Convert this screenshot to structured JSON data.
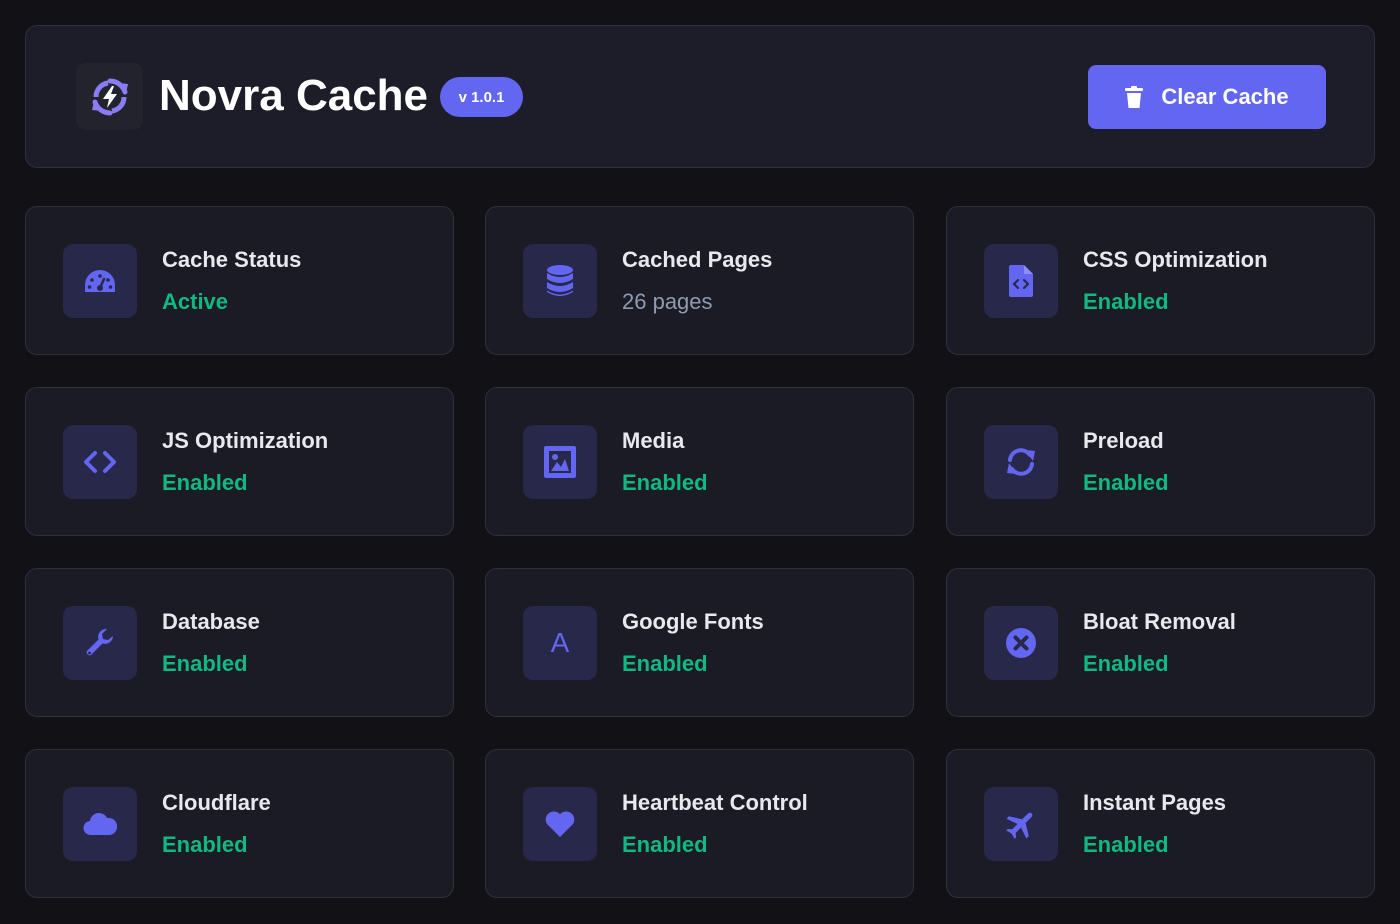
{
  "header": {
    "title": "Novra Cache",
    "version": "v 1.0.1",
    "clear_button_label": "Clear Cache",
    "logo_icon": "bolt-refresh-icon"
  },
  "colors": {
    "accent": "#6366f1",
    "success": "#10b981",
    "muted": "#8f9bb0",
    "card_bg": "#1b1b25",
    "page_bg": "#111116"
  },
  "cards": [
    {
      "title": "Cache Status",
      "value": "Active",
      "icon": "gauge-icon",
      "status": "success"
    },
    {
      "title": "Cached Pages",
      "value": "26 pages",
      "icon": "database-icon",
      "status": "muted"
    },
    {
      "title": "CSS Optimization",
      "value": "Enabled",
      "icon": "file-code-icon",
      "status": "success"
    },
    {
      "title": "JS Optimization",
      "value": "Enabled",
      "icon": "code-icon",
      "status": "success"
    },
    {
      "title": "Media",
      "value": "Enabled",
      "icon": "image-icon",
      "status": "success"
    },
    {
      "title": "Preload",
      "value": "Enabled",
      "icon": "sync-icon",
      "status": "success"
    },
    {
      "title": "Database",
      "value": "Enabled",
      "icon": "wrench-icon",
      "status": "success"
    },
    {
      "title": "Google Fonts",
      "value": "Enabled",
      "icon": "font-letter-icon",
      "icon_text": "A",
      "status": "success"
    },
    {
      "title": "Bloat Removal",
      "value": "Enabled",
      "icon": "circle-x-icon",
      "status": "success"
    },
    {
      "title": "Cloudflare",
      "value": "Enabled",
      "icon": "cloud-icon",
      "status": "success"
    },
    {
      "title": "Heartbeat Control",
      "value": "Enabled",
      "icon": "heart-icon",
      "status": "success"
    },
    {
      "title": "Instant Pages",
      "value": "Enabled",
      "icon": "plane-icon",
      "status": "success"
    }
  ]
}
